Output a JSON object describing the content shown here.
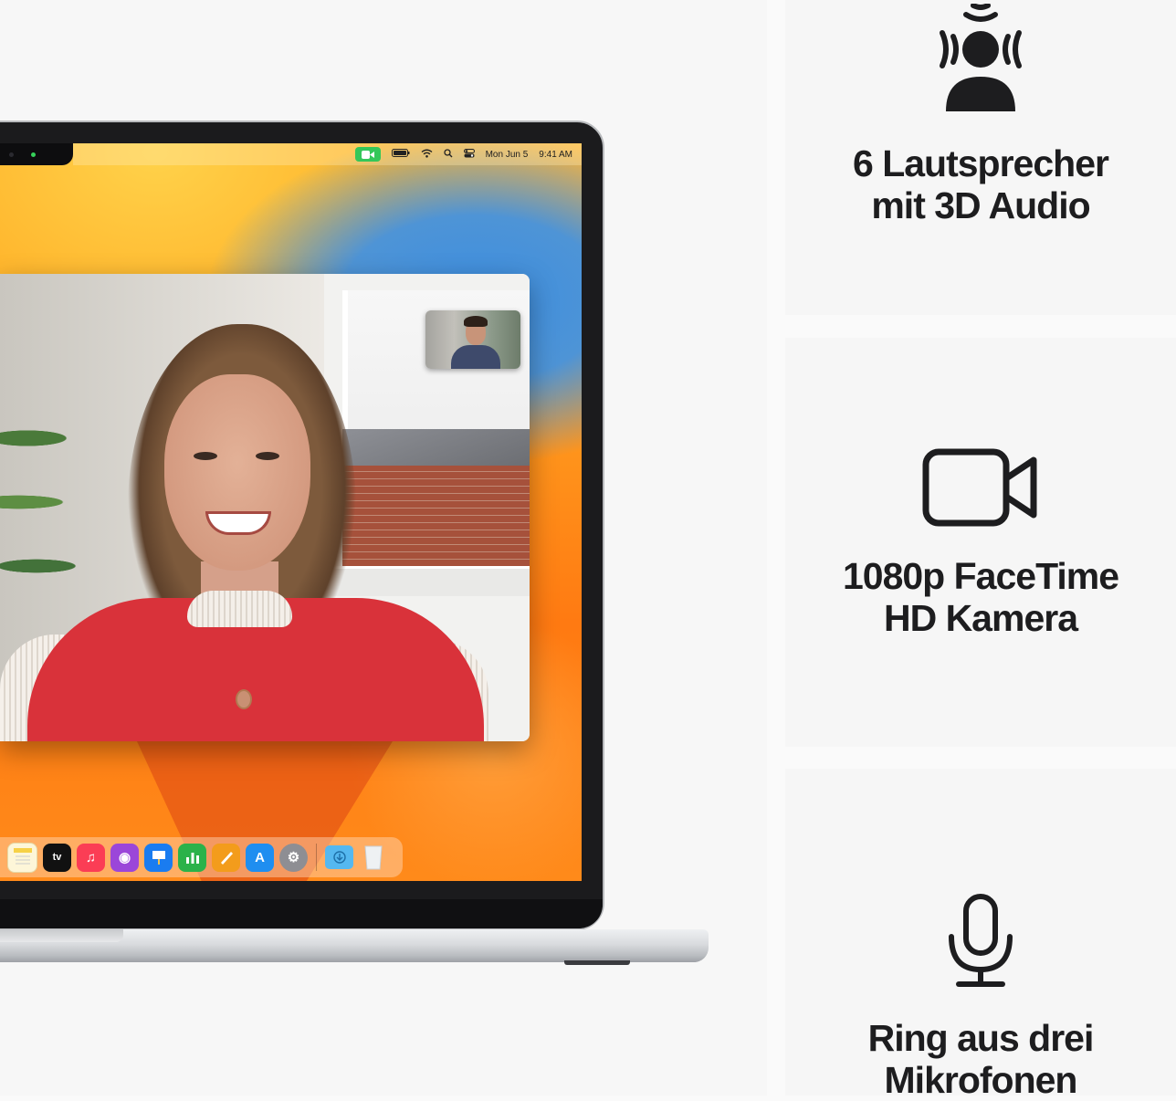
{
  "menubar": {
    "date": "Mon Jun 5",
    "time": "9:41 AM"
  },
  "dock": {
    "apps": [
      {
        "name": "notes",
        "glyph": "",
        "color": "#fdf6d8"
      },
      {
        "name": "apple-tv",
        "glyph": "tv",
        "color": "#111111"
      },
      {
        "name": "music",
        "glyph": "♫",
        "color": "#fb3d55"
      },
      {
        "name": "podcasts",
        "glyph": "◉",
        "color": "#9b46d9"
      },
      {
        "name": "keynote",
        "glyph": "▭",
        "color": "#1a7cf0"
      },
      {
        "name": "numbers",
        "glyph": "▮",
        "color": "#2bb24a"
      },
      {
        "name": "pages",
        "glyph": "✎",
        "color": "#f39c1c"
      },
      {
        "name": "app-store",
        "glyph": "A",
        "color": "#1f8ef0"
      },
      {
        "name": "system-settings",
        "glyph": "⚙",
        "color": "#8e8e93"
      }
    ],
    "right_apps": [
      {
        "name": "downloads-folder",
        "glyph": "◉",
        "color": "#55b8f0"
      },
      {
        "name": "trash",
        "glyph": "",
        "color": "#e8ecef"
      }
    ]
  },
  "features": [
    {
      "icon": "spatial-audio-person-icon",
      "line1": "6 Lautsprecher",
      "line2": "mit 3D Audio"
    },
    {
      "icon": "video-camera-icon",
      "line1": "1080p FaceTime",
      "line2": "HD Kamera"
    },
    {
      "icon": "microphone-icon",
      "line1": "Ring aus drei",
      "line2": "Mikrofonen"
    }
  ],
  "colors": {
    "text": "#1d1d1f",
    "panel_bg": "#f6f6f6",
    "facetime_green": "#34c759"
  }
}
